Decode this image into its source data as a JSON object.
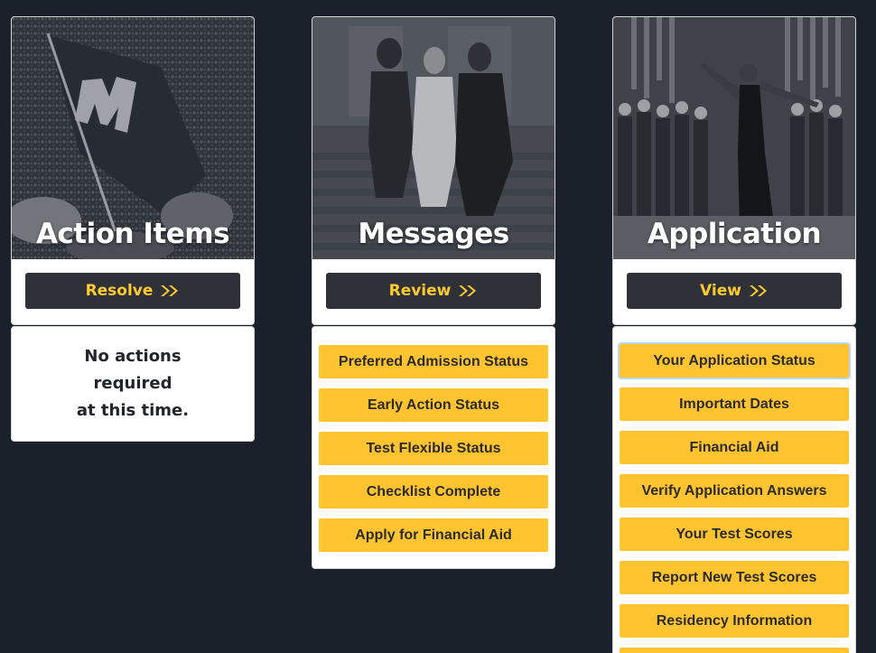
{
  "colors": {
    "background": "#1b212b",
    "button_dark": "#2e3138",
    "accent_yellow": "#ffc42f",
    "action_text": "#ffcb2f"
  },
  "cards": [
    {
      "title": "Action Items",
      "action_label": "Resolve",
      "action_icon": "double-chevron-right-icon",
      "image": "marching-band-flag-photo"
    },
    {
      "title": "Messages",
      "action_label": "Review",
      "action_icon": "double-chevron-right-icon",
      "image": "students-on-steps-photo"
    },
    {
      "title": "Application",
      "action_label": "View",
      "action_icon": "double-chevron-right-icon",
      "image": "choir-performer-photo"
    }
  ],
  "action_items": {
    "empty_message_line1": "No actions required",
    "empty_message_line2": "at this time."
  },
  "messages": {
    "items": [
      "Preferred Admission Status",
      "Early Action Status",
      "Test Flexible Status",
      "Checklist Complete",
      "Apply for Financial Aid"
    ]
  },
  "application": {
    "items": [
      "Your Application Status",
      "Important Dates",
      "Financial Aid",
      "Verify Application Answers",
      "Your Test Scores",
      "Report New Test Scores",
      "Residency Information"
    ]
  }
}
